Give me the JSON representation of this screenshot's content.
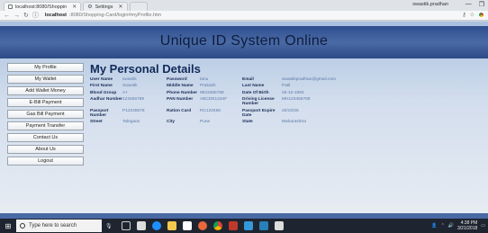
{
  "browser": {
    "tabs": [
      {
        "label": "localhost:8080/Shoppin"
      },
      {
        "label": "Settings"
      }
    ],
    "user": "swastik.pradhan",
    "address": {
      "host": "localhost",
      "port_path": ":8080/Shopping-Card/login#myProfile.htm"
    }
  },
  "site_title": "Unique ID System Online",
  "menu": [
    "My Profile",
    "My Wallet",
    "Add Wallet Money",
    "E-Bill Payment",
    "Gas Bill Payment",
    "Payment Transfer",
    "Contact Us",
    "About Us",
    "Logout"
  ],
  "heading": "My Personal Details",
  "details": [
    [
      "User Name",
      "swastik",
      "Password",
      "tanu",
      "Email",
      "swastikpradhan@gmail.com"
    ],
    [
      "First Name",
      "Swastik",
      "Middle Name",
      "Prakash",
      "Last Name",
      "Patil"
    ],
    [
      "Blood Group",
      "A+",
      "Phone Number",
      "9823456789",
      "Date Of Birth",
      "25-10-1994"
    ],
    [
      "Aadhar Number",
      "123456789",
      "PAN Number",
      "ABCDE1234F",
      "Driving License Number",
      "MH123456789"
    ],
    [
      "Passport Number",
      "P12345678",
      "Ration Card",
      "RC123456",
      "Passport Expire Date",
      "20/10/25"
    ],
    [
      "Street",
      "Talegaon",
      "City",
      "Pune",
      "State",
      "Maharashtra"
    ]
  ],
  "taskbar": {
    "search_placeholder": "Type here to search",
    "time": "4:38 PM",
    "date": "3/21/2018"
  },
  "colors": {
    "header_blue": "#2e4e8e",
    "label_navy": "#1b2d55",
    "value_blue": "#5d7aa8"
  }
}
